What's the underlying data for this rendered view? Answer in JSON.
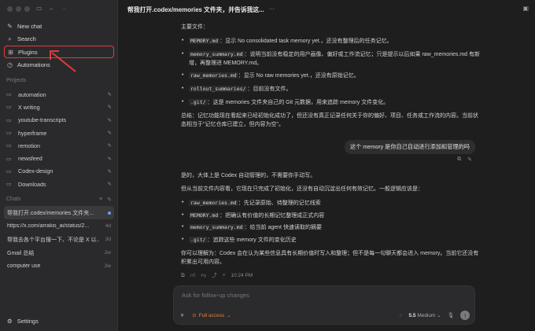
{
  "sidebar": {
    "nav": [
      {
        "label": "New chat",
        "icon": "new-chat-icon"
      },
      {
        "label": "Search",
        "icon": "search-icon"
      },
      {
        "label": "Plugins",
        "icon": "plugins-icon"
      },
      {
        "label": "Automations",
        "icon": "clock-icon"
      }
    ],
    "projects_label": "Projects",
    "projects": [
      "automation",
      "X writing",
      "youtube-transcripts",
      "hyperframe",
      "remotion",
      "newsfeed",
      "Codex-design",
      "Downloads"
    ],
    "chats_label": "Chats",
    "chats": [
      {
        "title": "帮我打开.codex/memories 文件夹...",
        "meta": ""
      },
      {
        "title": "https://x.com/arrakis_ai/status/2...",
        "meta": "4d"
      },
      {
        "title": "帮我去各个平台搜一下、不论是 X 以...",
        "meta": "3d"
      },
      {
        "title": "Gmail 总结",
        "meta": "2w"
      },
      {
        "title": "computer use",
        "meta": "2w"
      }
    ],
    "settings_label": "Settings"
  },
  "header": {
    "title": "帮我打开.codex/memories 文件夹，并告诉我这...",
    "more": "···"
  },
  "message1": {
    "heading": "主要文件：",
    "items": [
      {
        "code": "MEMORY.md",
        "text": "：显示 No consolidated task memory yet.，还没有整理后的任务记忆。"
      },
      {
        "code": "memory_summary.md",
        "text": "：说明当前没有稳定的用户画像、偏好或工作流记忆；只是提示以后如果 raw_memories.md 有新增，再整理进 MEMORY.md。"
      },
      {
        "code": "raw_memories.md",
        "text": "：显示 No raw memories yet.，还没有原始记忆。"
      },
      {
        "code": "rollout_summaries/",
        "text": "：目前没有文件。"
      },
      {
        "code": ".git/",
        "text": "：这是 memories 文件夹自己的 Git 元数据，用来追踪 memory 文件变化。"
      }
    ],
    "summary": "总结：记忆功能现在看起来已经初始化成功了，但还没有真正记录任何关于你的偏好、项目、任务或工作流的内容。当前状态相当于\"记忆仓库已建立，但内容为空\"。"
  },
  "user_message": "这个 memory 是你自己自动进行添加和管理的吗",
  "message2": {
    "p1": "是的，大体上是 Codex 自动管理的，不需要你手动写。",
    "p2": "但从当前文件内容看，它现在只完成了初始化，还没有自动沉淀出任何有效记忆。一般逻辑应该是：",
    "items": [
      {
        "code": "raw_memories.md",
        "text": "：先记录原始、待整理的记忆线索"
      },
      {
        "code": "MEMORY.md",
        "text": "：把确认有价值的长期记忆整理成正式内容"
      },
      {
        "code": "memory_summary.md",
        "text": "：给当前 agent 快速读取的摘要"
      },
      {
        "code": ".git/",
        "text": "：追踪这些 memory 文件的变化历史"
      }
    ],
    "p3": "你可以理解为：Codex 会在认为某些信息具有长期价值时写入和整理；但不是每一句聊天都会进入 memory。当前它还没有积累出可用内容。",
    "time": "10:24 PM"
  },
  "composer": {
    "placeholder": "Ask for follow-up changes",
    "access": "Full access",
    "model": "5.5",
    "effort": "Medium"
  },
  "colors": {
    "highlight": "#e23b3b",
    "access": "#e3803b",
    "unread": "#6e9ef0"
  }
}
